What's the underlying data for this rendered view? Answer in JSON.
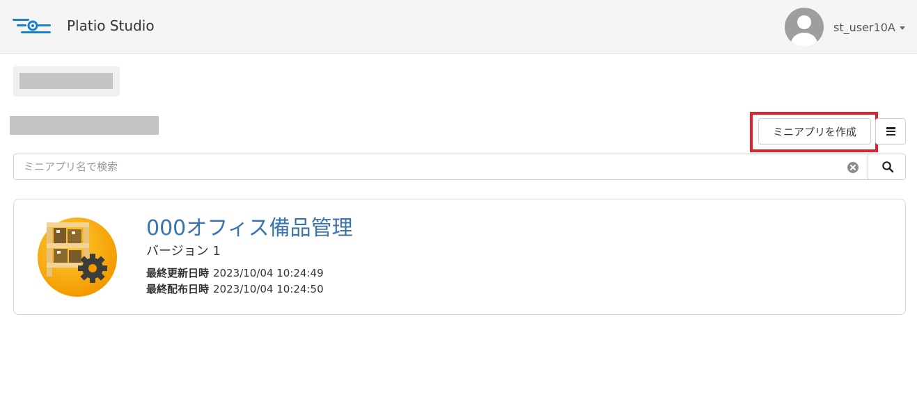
{
  "header": {
    "app_title": "Platio Studio",
    "user_name": "st_user10A",
    "brand_color": "#1a7fd4"
  },
  "toolbar": {
    "create_label": "ミニアプリを作成",
    "menu_icon": "hamburger-icon",
    "highlight_color": "#e0232b"
  },
  "search": {
    "placeholder": "ミニアプリ名で検索",
    "value": ""
  },
  "apps": [
    {
      "name": "000オフィス備品管理",
      "version": "バージョン 1",
      "updated_label": "最終更新日時",
      "updated_value": "2023/10/04 10:24:49",
      "published_label": "最終配布日時",
      "published_value": "2023/10/04 10:24:50",
      "icon": "shelf-gear-icon",
      "name_color": "#3a74b0"
    }
  ]
}
